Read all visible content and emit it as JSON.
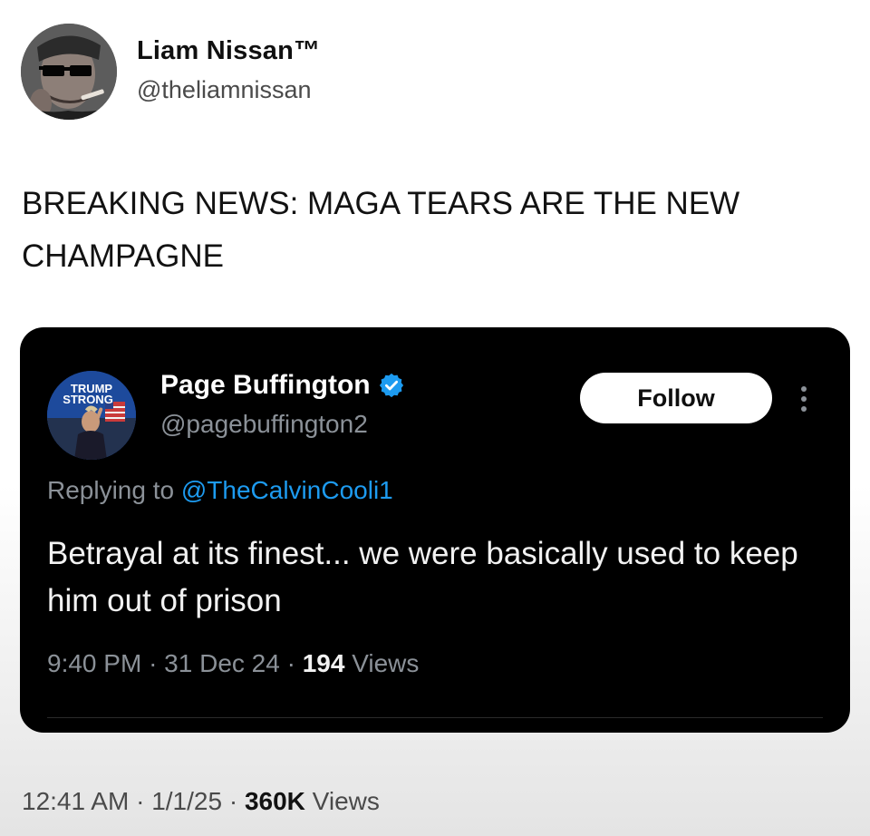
{
  "author": {
    "name": "Liam Nissan™",
    "handle": "@theliamnissan"
  },
  "tweet": {
    "text": "BREAKING NEWS: MAGA TEARS ARE THE NEW CHAMPAGNE",
    "time": "12:41 AM",
    "date": "1/1/25",
    "views_count": "360K",
    "views_label": "Views",
    "separator": "·"
  },
  "quoted_tweet": {
    "avatar_text_line1": "TRUMP",
    "avatar_text_line2": "STRONG",
    "name": "Page Buffington",
    "handle": "@pagebuffington2",
    "follow_label": "Follow",
    "replying_prefix": "Replying to",
    "replying_to": "@TheCalvinCooli1",
    "text": "Betrayal at its finest... we were basically used to keep him out of prison",
    "time": "9:40 PM",
    "date": "31 Dec 24",
    "views_count": "194",
    "views_label": "Views",
    "separator": "·"
  },
  "colors": {
    "card_background": "#000000",
    "verified_blue": "#1d9bf0",
    "mention_blue": "#1d9bf0",
    "muted_text": "#8b9198"
  },
  "icons": {
    "verified": "verified-badge-icon",
    "more": "more-options-icon"
  }
}
